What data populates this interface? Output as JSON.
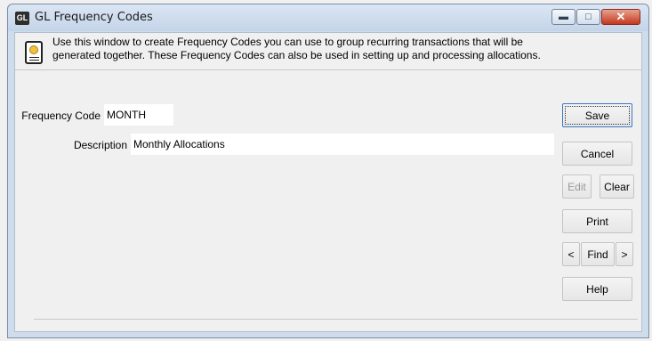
{
  "window": {
    "title": "GL Frequency Codes",
    "app_badge": "GL",
    "controls": {
      "minimize": "▬",
      "maximize": "□",
      "close": "✕"
    }
  },
  "info": {
    "icon": "certificate-icon",
    "line1": "Use this window to create Frequency Codes you can use to group recurring transactions that will be",
    "line2": "generated together. These Frequency Codes can also be used in setting up and processing allocations."
  },
  "form": {
    "frequency_code_label": "Frequency Code",
    "frequency_code_value": "MONTH",
    "description_label": "Description",
    "description_value": "Monthly Allocations"
  },
  "buttons": {
    "save": "Save",
    "cancel": "Cancel",
    "edit": "Edit",
    "clear": "Clear",
    "print": "Print",
    "prev": "<",
    "find": "Find",
    "next": ">",
    "help": "Help"
  },
  "colors": {
    "default_button_border": "#3a76c4",
    "close_button": "#c2391d"
  }
}
